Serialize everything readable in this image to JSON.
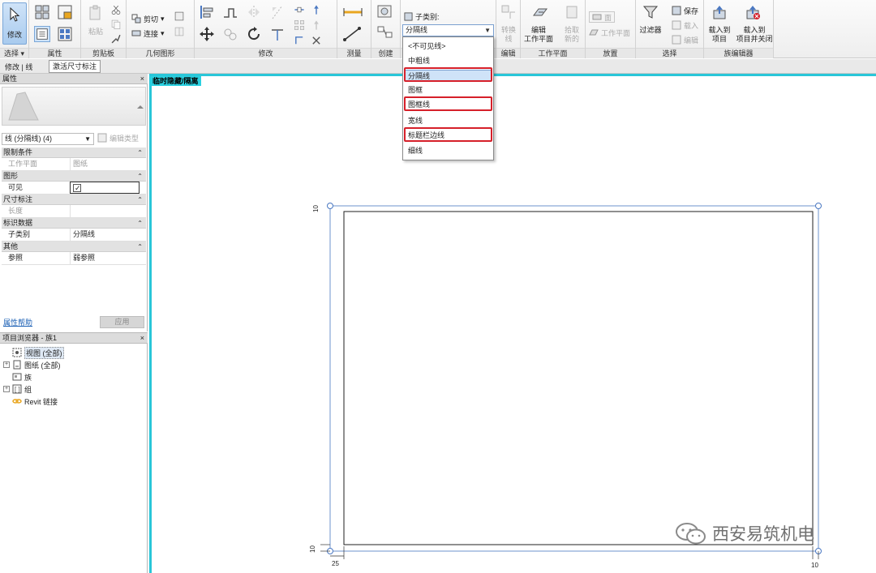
{
  "ribbon": {
    "panels": {
      "select": "选择 ▾",
      "properties": "属性",
      "clipboard": "剪贴板",
      "geometry": "几何图形",
      "modify": "修改",
      "measure": "测量",
      "create": "创建",
      "edit": "编辑",
      "workplane": "工作平面",
      "place": "放置",
      "selection": "选择",
      "family_editor": "族编辑器"
    },
    "buttons": {
      "modify": "修改",
      "paste": "粘贴",
      "cut": "剪切",
      "join": "连接",
      "convert_line": "转换\n线",
      "edit_workplane": "编辑\n工作平面",
      "pick_new": "拾取\n新的",
      "workplane_ref": "工作平面",
      "filter": "过滤器",
      "save": "保存",
      "load": "载入",
      "edit_sel": "编辑",
      "load_to_project": "载入到\n项目",
      "load_to_project_close": "载入到\n项目并关闭",
      "place_dim": "线"
    },
    "subcategory": {
      "label": "子类别:",
      "selected": "分隔线",
      "options": [
        "<不可见线>",
        "中粗线",
        "分隔线",
        "图框",
        "图框线",
        "宽线",
        "标题栏边线",
        "细线"
      ],
      "selected_index": 2,
      "highlighted_options": [
        "分隔线",
        "图框线",
        "标题栏边线"
      ]
    }
  },
  "context_bar": {
    "context": "修改 | 线",
    "dim_button": "激活尺寸标注"
  },
  "properties": {
    "title": "属性",
    "close": "×",
    "type_name": "线 (分隔线) (4)",
    "edit_type": "编辑类型",
    "groups": [
      {
        "name": "限制条件",
        "rows": [
          {
            "key": "工作平面",
            "value": "图纸",
            "dim": true
          }
        ]
      },
      {
        "name": "图形",
        "rows": [
          {
            "key": "可见",
            "value": "",
            "checkbox": true
          }
        ]
      },
      {
        "name": "尺寸标注",
        "rows": [
          {
            "key": "长度",
            "value": "",
            "dim": true
          }
        ]
      },
      {
        "name": "标识数据",
        "rows": [
          {
            "key": "子类别",
            "value": "分隔线"
          }
        ]
      },
      {
        "name": "其他",
        "rows": [
          {
            "key": "参照",
            "value": "弱参照"
          }
        ]
      }
    ],
    "help_link": "属性帮助",
    "apply": "应用"
  },
  "browser": {
    "title": "项目浏览器 - 族1",
    "close": "×",
    "nodes": [
      {
        "label": "视图 (全部)",
        "icon": "views-icon",
        "expand": "",
        "highlight": true
      },
      {
        "label": "图纸 (全部)",
        "icon": "sheets-icon",
        "expand": "+"
      },
      {
        "label": "族",
        "icon": "families-icon",
        "expand": ""
      },
      {
        "label": "组",
        "icon": "groups-icon",
        "expand": "+"
      },
      {
        "label": "Revit 链接",
        "icon": "revit-links-icon",
        "expand": ""
      }
    ]
  },
  "canvas": {
    "banner": "临时隐藏/隔离",
    "dims": {
      "top_left": "10",
      "bottom_left": "10",
      "bottom_offset": "25",
      "bottom_right": "10"
    },
    "colors": {
      "border": "#29c6d8",
      "line": "#1f1f1f",
      "select": "#4a78c2"
    }
  },
  "watermark": "西安易筑机电"
}
